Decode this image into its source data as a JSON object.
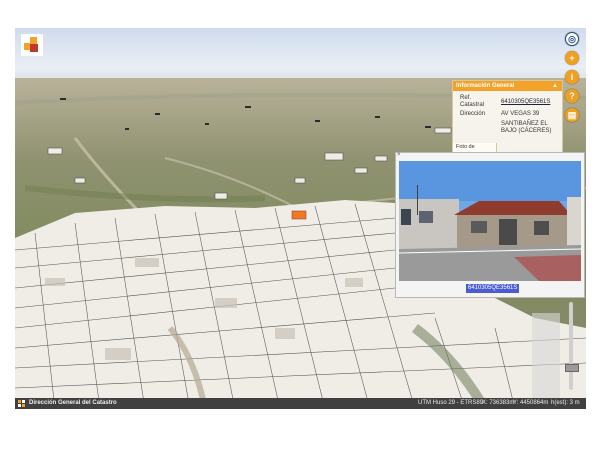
{
  "map": {
    "nav_buttons": [
      {
        "name": "compass-icon",
        "glyph": "◎"
      },
      {
        "name": "zoom-in-button",
        "glyph": "+"
      },
      {
        "name": "info-button",
        "glyph": "i"
      },
      {
        "name": "help-button",
        "glyph": "?"
      },
      {
        "name": "layers-button",
        "glyph": "▤"
      }
    ]
  },
  "info_panel": {
    "title": "Información General",
    "toggle": "▲",
    "ref_label": "Ref. Catastral",
    "ref_value": "6410305QE3561S",
    "dir_label": "Dirección",
    "dir_value": "AV VEGAS 39",
    "locality": "SANTIBAÑEZ EL BAJO (CÁCERES)",
    "foto_tab": "Foto de Fachada"
  },
  "photo_popup": {
    "close": "×",
    "ref_link": "6410305QE3561S"
  },
  "statusbar": {
    "org": "Dirección General del Catastro",
    "crs": "UTM Huso 29 - ETRS89",
    "x": "X: 736383m",
    "y": "Y: 4450864m",
    "h": "h(est): 3 m"
  },
  "colors": {
    "accent": "#f2a228",
    "link_highlight": "#4b5bd0",
    "statusbar": "#404040"
  }
}
